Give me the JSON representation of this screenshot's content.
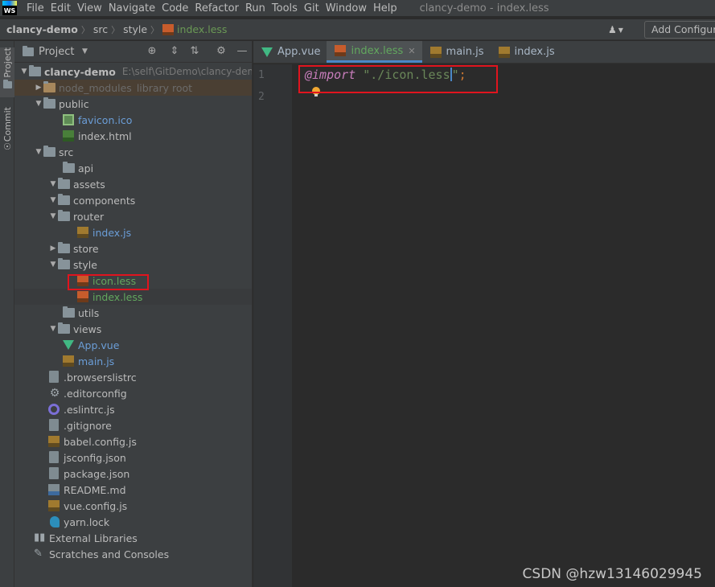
{
  "app": {
    "logo_text": "WS",
    "menu": [
      "File",
      "Edit",
      "View",
      "Navigate",
      "Code",
      "Refactor",
      "Run",
      "Tools",
      "Git",
      "Window",
      "Help"
    ],
    "window_title": "clancy-demo - index.less"
  },
  "navbar": {
    "crumbs": [
      "clancy-demo",
      "src",
      "style"
    ],
    "file": "index.less",
    "add_config": "Add Configur"
  },
  "side_stripe": {
    "project": "Project",
    "commit": "Commit"
  },
  "project_panel": {
    "title": "Project",
    "root": {
      "name": "clancy-demo",
      "path": "E:\\self\\GitDemo\\clancy-demo"
    },
    "node_modules": {
      "name": "node_modules",
      "note": "library root"
    },
    "items": {
      "public": "public",
      "favicon": "favicon.ico",
      "index_html": "index.html",
      "src": "src",
      "api": "api",
      "assets": "assets",
      "components": "components",
      "router": "router",
      "router_index": "index.js",
      "store": "store",
      "style": "style",
      "icon_less": "icon.less",
      "index_less": "index.less",
      "utils": "utils",
      "views": "views",
      "app_vue": "App.vue",
      "main_js": "main.js",
      "browserslistrc": ".browserslistrc",
      "editorconfig": ".editorconfig",
      "eslintrc": ".eslintrc.js",
      "gitignore": ".gitignore",
      "babel": "babel.config.js",
      "jsconfig": "jsconfig.json",
      "package": "package.json",
      "readme": "README.md",
      "vueconfig": "vue.config.js",
      "yarnlock": "yarn.lock",
      "external": "External Libraries",
      "scratches": "Scratches and Consoles"
    }
  },
  "editor": {
    "tabs": [
      "App.vue",
      "index.less",
      "main.js",
      "index.js"
    ],
    "active_tab": "index.less",
    "line_numbers": [
      "1",
      "2"
    ],
    "code": {
      "kw": "@import",
      "str_a": "\"./icon.less",
      "str_b": "\"",
      "punct": ";"
    }
  },
  "watermark": "CSDN @hzw13146029945",
  "colors": {
    "highlight_box": "#e0141e",
    "accent": "#4a88c7"
  }
}
